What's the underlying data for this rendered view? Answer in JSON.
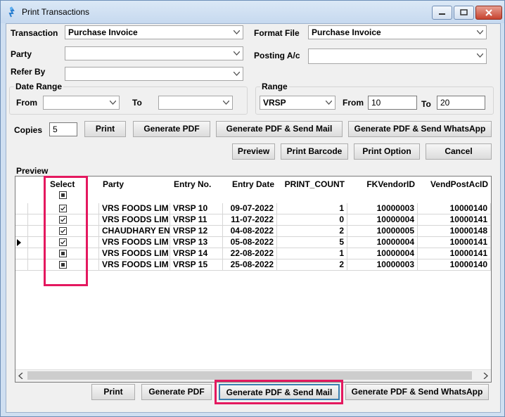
{
  "window": {
    "title": "Print Transactions"
  },
  "form": {
    "transaction_label": "Transaction",
    "transaction_value": "Purchase Invoice",
    "format_file_label": "Format File",
    "format_file_value": "Purchase Invoice",
    "party_label": "Party",
    "party_value": "",
    "posting_label": "Posting A/c",
    "posting_value": "",
    "refer_by_label": "Refer By",
    "refer_by_value": ""
  },
  "date_range": {
    "title": "Date Range",
    "from_label": "From",
    "from_value": "",
    "to_label": "To",
    "to_value": ""
  },
  "range": {
    "title": "Range",
    "series_value": "VRSP",
    "from_label": "From",
    "from_value": "10",
    "to_label": "To",
    "to_value": "20"
  },
  "copies": {
    "label": "Copies",
    "value": "5"
  },
  "buttons_top": {
    "print": "Print",
    "generate_pdf": "Generate PDF",
    "generate_pdf_mail": "Generate PDF & Send Mail",
    "generate_pdf_whatsapp": "Generate PDF & Send WhatsApp",
    "preview": "Preview",
    "print_barcode": "Print Barcode",
    "print_option": "Print Option",
    "cancel": "Cancel"
  },
  "preview": {
    "title": "Preview",
    "columns": [
      "Select",
      "Party",
      "Entry No.",
      "Entry Date",
      "PRINT_COUNT",
      "FKVendorID",
      "VendPostAcID"
    ],
    "header_select_state": "indeterminate",
    "rows": [
      {
        "select": "checked",
        "party": "VRS FOODS LIM",
        "entry_no": "VRSP 10",
        "entry_date": "09-07-2022",
        "print_count": "1",
        "vendor_id": "10000003",
        "post_ac_id": "10000140"
      },
      {
        "select": "checked",
        "party": "VRS FOODS LIM",
        "entry_no": "VRSP 11",
        "entry_date": "11-07-2022",
        "print_count": "0",
        "vendor_id": "10000004",
        "post_ac_id": "10000141"
      },
      {
        "select": "checked",
        "party": "CHAUDHARY EN",
        "entry_no": "VRSP 12",
        "entry_date": "04-08-2022",
        "print_count": "2",
        "vendor_id": "10000005",
        "post_ac_id": "10000148"
      },
      {
        "select": "checked",
        "party": "VRS FOODS LIM",
        "entry_no": "VRSP 13",
        "entry_date": "05-08-2022",
        "print_count": "5",
        "vendor_id": "10000004",
        "post_ac_id": "10000141"
      },
      {
        "select": "indeterminate",
        "party": "VRS FOODS LIM",
        "entry_no": "VRSP 14",
        "entry_date": "22-08-2022",
        "print_count": "1",
        "vendor_id": "10000004",
        "post_ac_id": "10000141"
      },
      {
        "select": "indeterminate",
        "party": "VRS FOODS LIM",
        "entry_no": "VRSP 15",
        "entry_date": "25-08-2022",
        "print_count": "2",
        "vendor_id": "10000003",
        "post_ac_id": "10000140"
      }
    ],
    "current_row": 3
  },
  "buttons_bottom": {
    "print": "Print",
    "generate_pdf": "Generate PDF",
    "generate_pdf_mail": "Generate PDF & Send Mail",
    "generate_pdf_whatsapp": "Generate PDF & Send WhatsApp"
  },
  "colors": {
    "highlight": "#e4185f",
    "title_bar": "#cfdff1",
    "focus_border": "#3c7fb1"
  },
  "icons": [
    "app-icon",
    "minimize-icon",
    "maximize-icon",
    "close-icon",
    "chevron-down-icon",
    "row-pointer-icon",
    "scroll-left-icon",
    "scroll-right-icon"
  ]
}
